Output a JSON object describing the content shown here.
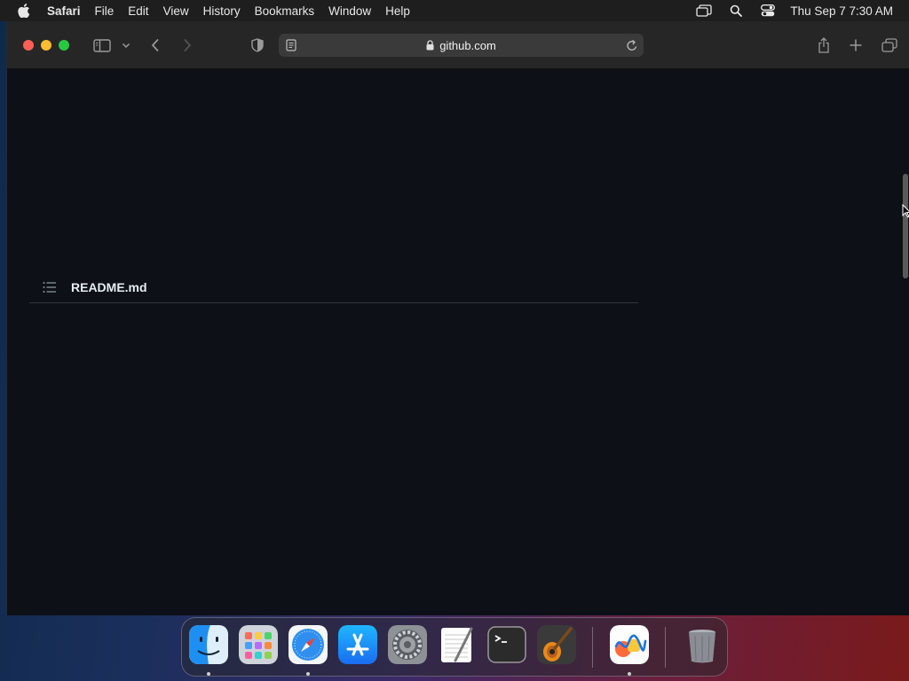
{
  "menubar": {
    "app_name": "Safari",
    "items": [
      "File",
      "Edit",
      "View",
      "History",
      "Bookmarks",
      "Window",
      "Help"
    ],
    "clock": "Thu Sep 7  7:30 AM",
    "status_icons": [
      "screen-mirroring-icon",
      "spotlight-search-icon",
      "control-center-icon"
    ]
  },
  "browser": {
    "address": "github.com",
    "secure": true
  },
  "page": {
    "readme_title": "README.md"
  },
  "dock": {
    "apps": [
      {
        "name": "Finder",
        "icon": "finder-icon",
        "running": true
      },
      {
        "name": "Launchpad",
        "icon": "launchpad-icon",
        "running": false
      },
      {
        "name": "Safari",
        "icon": "safari-icon",
        "running": true
      },
      {
        "name": "App Store",
        "icon": "app-store-icon",
        "running": false
      },
      {
        "name": "System Settings",
        "icon": "system-settings-icon",
        "running": false
      },
      {
        "name": "TextEdit",
        "icon": "textedit-icon",
        "running": false
      },
      {
        "name": "Terminal",
        "icon": "terminal-icon",
        "running": false
      },
      {
        "name": "GarageBand",
        "icon": "garageband-icon",
        "running": false
      },
      {
        "name": "Freeform",
        "icon": "freeform-icon",
        "running": true
      },
      {
        "name": "Trash",
        "icon": "trash-icon",
        "running": false
      }
    ]
  },
  "colors": {
    "page_bg": "#0d1117",
    "toolbar_bg": "#262626",
    "close": "#ff5f57",
    "minimize": "#febc2e",
    "maximize": "#28c840"
  }
}
